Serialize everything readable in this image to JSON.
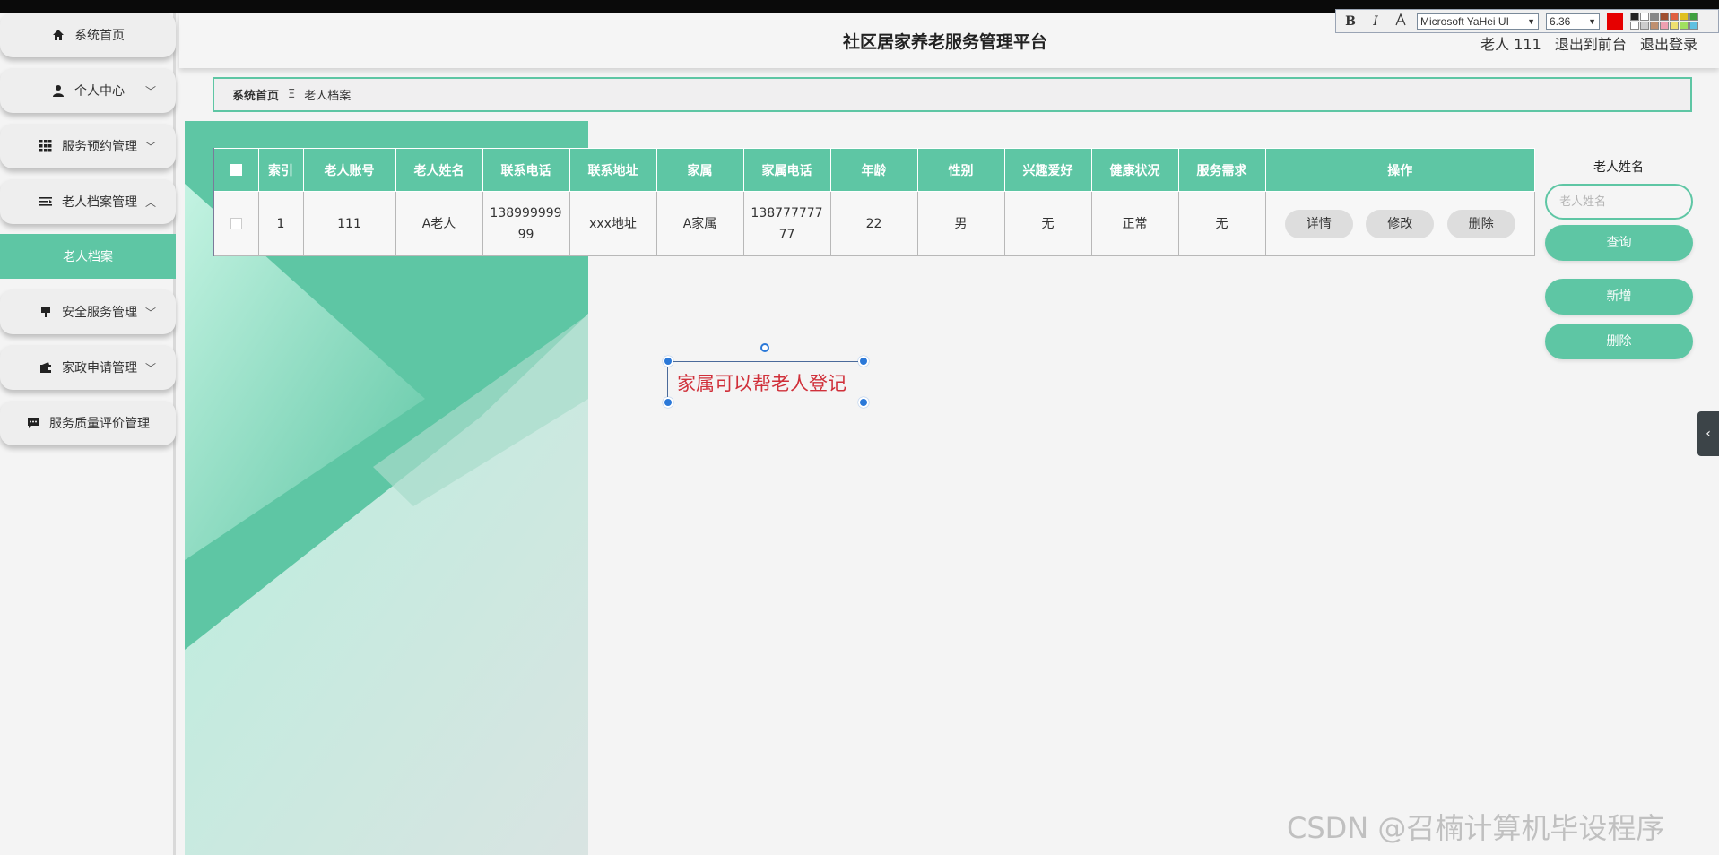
{
  "header": {
    "title": "社区居家养老服务管理平台",
    "user_label": "老人 111",
    "back_link": "退出到前台",
    "logout_link": "退出登录"
  },
  "format_toolbar": {
    "bold": "B",
    "italic": "I",
    "font_name": "Microsoft YaHei UI",
    "font_size": "6.36",
    "color": "#e60000"
  },
  "sidebar": {
    "items": [
      {
        "label": "系统首页",
        "icon": "home-icon"
      },
      {
        "label": "个人中心",
        "icon": "user-icon"
      },
      {
        "label": "服务预约管理",
        "icon": "grid-icon"
      },
      {
        "label": "老人档案管理",
        "icon": "list-icon"
      },
      {
        "label": "安全服务管理",
        "icon": "shield-icon"
      },
      {
        "label": "家政申请管理",
        "icon": "wallet-icon"
      },
      {
        "label": "服务质量评价管理",
        "icon": "chat-icon"
      }
    ],
    "active_sub": "老人档案"
  },
  "breadcrumb": {
    "home": "系统首页",
    "separator": "Ξ",
    "current": "老人档案"
  },
  "table": {
    "headers": [
      "",
      "索引",
      "老人账号",
      "老人姓名",
      "联系电话",
      "联系地址",
      "家属",
      "家属电话",
      "年龄",
      "性别",
      "兴趣爱好",
      "健康状况",
      "服务需求",
      "操作"
    ],
    "rows": [
      {
        "index": "1",
        "account": "111",
        "name": "A老人",
        "phone_line1": "138999999",
        "phone_line2": "99",
        "address": "xxx地址",
        "family": "A家属",
        "family_phone_line1": "138777777",
        "family_phone_line2": "77",
        "age": "22",
        "gender": "男",
        "hobby": "无",
        "health": "正常",
        "needs": "无"
      }
    ],
    "actions": {
      "detail": "详情",
      "edit": "修改",
      "delete": "删除"
    }
  },
  "search": {
    "label": "老人姓名",
    "placeholder": "老人姓名",
    "query_button": "查询",
    "add_button": "新增",
    "delete_button": "删除"
  },
  "annotation": {
    "text": "家属可以帮老人登记",
    "color": "#d0303a"
  },
  "colors": {
    "accent": "#5ec6a4"
  },
  "watermark": "CSDN @召楠计算机毕设程序"
}
